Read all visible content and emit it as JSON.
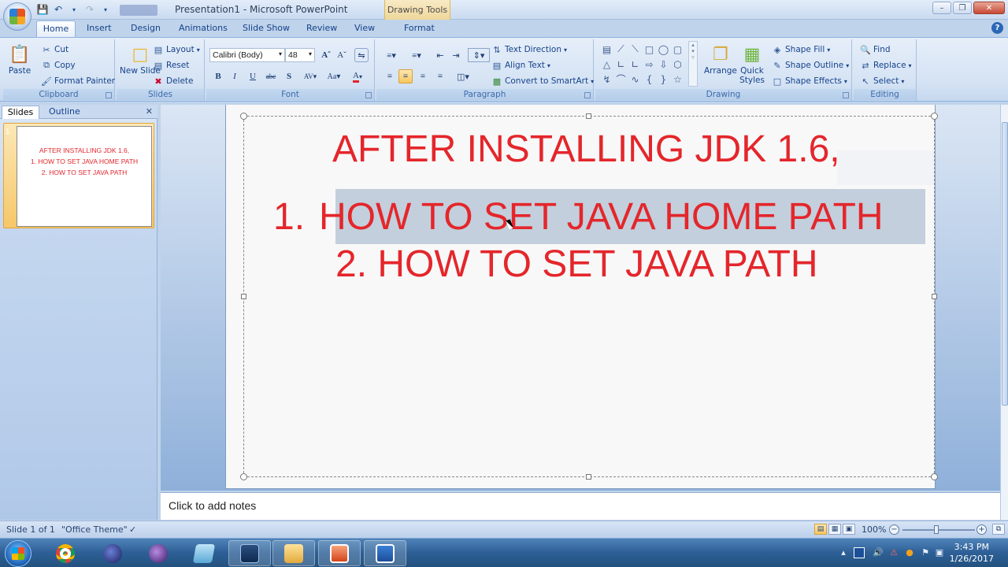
{
  "window": {
    "title": "Presentation1 - Microsoft PowerPoint",
    "contextual_tab_title": "Drawing Tools"
  },
  "ribbon_tabs": [
    "Home",
    "Insert",
    "Design",
    "Animations",
    "Slide Show",
    "Review",
    "View",
    "Format"
  ],
  "ribbon": {
    "clipboard": {
      "label": "Clipboard",
      "paste": "Paste",
      "cut": "Cut",
      "copy": "Copy",
      "format_painter": "Format Painter"
    },
    "slides": {
      "label": "Slides",
      "new_slide": "New Slide",
      "layout": "Layout",
      "reset": "Reset",
      "delete": "Delete"
    },
    "font": {
      "label": "Font",
      "font_name": "Calibri (Body)",
      "font_size": "48"
    },
    "paragraph": {
      "label": "Paragraph",
      "text_direction": "Text Direction",
      "align_text": "Align Text",
      "convert_smartart": "Convert to SmartArt"
    },
    "drawing": {
      "label": "Drawing",
      "arrange": "Arrange",
      "quick_styles": "Quick Styles",
      "shape_fill": "Shape Fill",
      "shape_outline": "Shape Outline",
      "shape_effects": "Shape Effects"
    },
    "editing": {
      "label": "Editing",
      "find": "Find",
      "replace": "Replace",
      "select": "Select"
    }
  },
  "left_pane": {
    "tabs": [
      "Slides",
      "Outline"
    ],
    "slide_number": "1",
    "thumbnail_lines": [
      "AFTER INSTALLING JDK 1.6,",
      "1. HOW TO SET JAVA HOME PATH",
      "2.  HOW TO SET JAVA PATH"
    ]
  },
  "slide": {
    "line1": "AFTER INSTALLING JDK 1.6,",
    "line2_num": "1.",
    "line2_text": "HOW TO SET JAVA HOME PATH",
    "line3": "2.  HOW TO SET JAVA PATH",
    "text_color": "#e4262b"
  },
  "notes": {
    "placeholder": "Click to add notes"
  },
  "status": {
    "slide_info": "Slide 1 of 1",
    "theme": "\"Office Theme\"",
    "zoom": "100%"
  },
  "taskbar": {
    "time": "3:43 PM",
    "date": "1/26/2017"
  }
}
